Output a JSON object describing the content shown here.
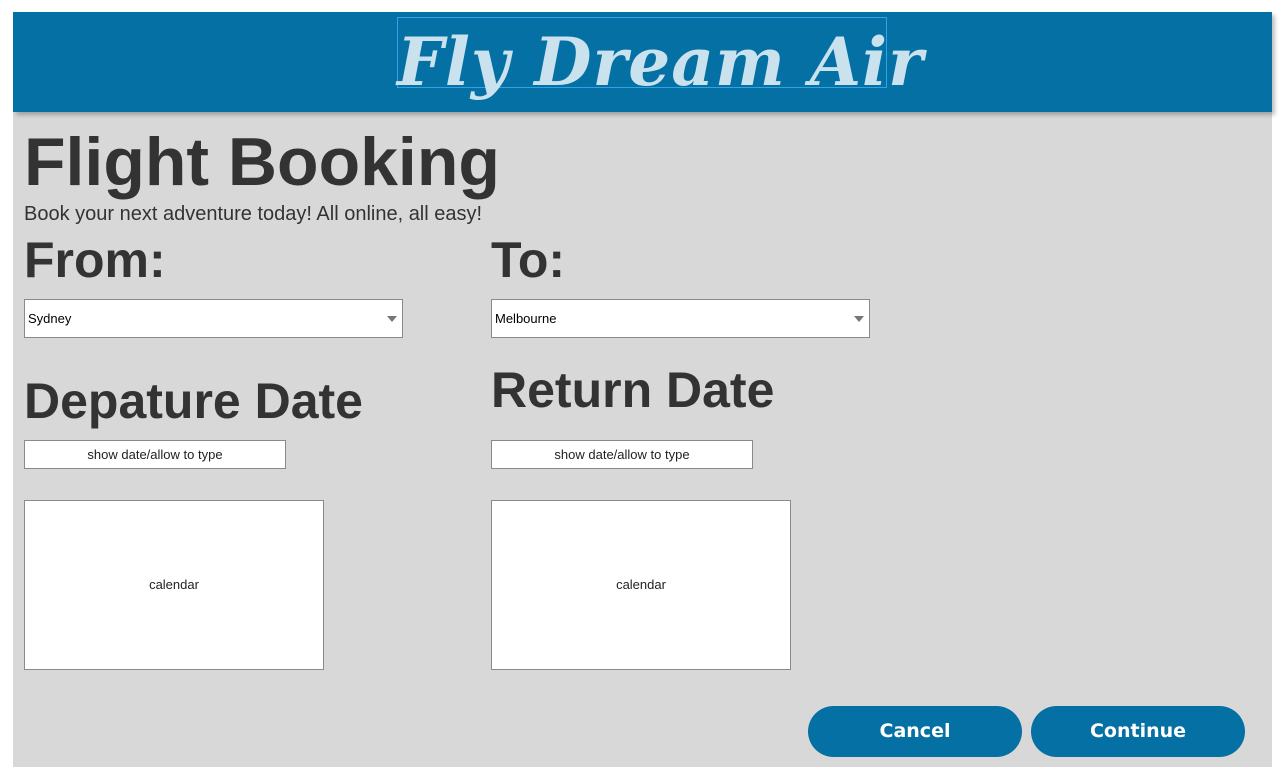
{
  "header": {
    "logo_text": "Fly Dream Air",
    "color": "#0570a3"
  },
  "page": {
    "title": "Flight Booking",
    "subtitle": "Book your next adventure today! All online, all easy!"
  },
  "from": {
    "label": "From:",
    "selected": "Sydney"
  },
  "to": {
    "label": "To:",
    "selected": "Melbourne"
  },
  "departure": {
    "label": "Depature Date",
    "input_text": "show date/allow to type",
    "calendar_text": "calendar"
  },
  "return": {
    "label": "Return Date",
    "input_text": "show date/allow to type",
    "calendar_text": "calendar"
  },
  "actions": {
    "cancel_label": "Cancel",
    "continue_label": "Continue"
  },
  "colors": {
    "background": "#d8d8d8",
    "accent": "#0570a3",
    "logo": "#c9e2ee",
    "text": "#333333"
  },
  "icons": {
    "dropdown": "chevron-down-icon"
  }
}
